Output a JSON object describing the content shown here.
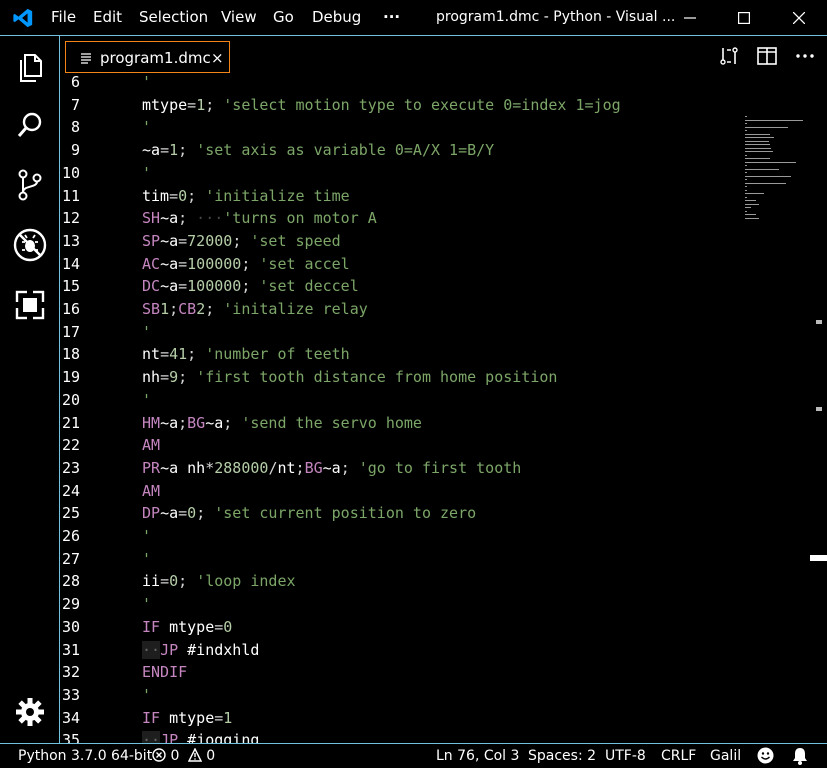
{
  "titlebar": {
    "menu": [
      "File",
      "Edit",
      "Selection",
      "View",
      "Go",
      "Debug"
    ],
    "more": "···",
    "title": "program1.dmc - Python - Visual ..."
  },
  "tab": {
    "filename": "program1.dmc",
    "close": "×"
  },
  "editor": {
    "lines": [
      {
        "n": "6",
        "t": [
          [
            "cmt",
            "'"
          ]
        ]
      },
      {
        "n": "7",
        "t": [
          [
            "var",
            "mtype"
          ],
          [
            "op",
            "="
          ],
          [
            "num",
            "1"
          ],
          [
            "op",
            ";"
          ],
          [
            "ws",
            " "
          ],
          [
            "cmt",
            "'select motion type to execute 0=index 1=jog"
          ]
        ]
      },
      {
        "n": "8",
        "t": [
          [
            "cmt",
            "'"
          ]
        ]
      },
      {
        "n": "9",
        "t": [
          [
            "var",
            "~a"
          ],
          [
            "op",
            "="
          ],
          [
            "num",
            "1"
          ],
          [
            "op",
            ";"
          ],
          [
            "ws",
            " "
          ],
          [
            "cmt",
            "'set axis as variable 0=A/X 1=B/Y"
          ]
        ]
      },
      {
        "n": "10",
        "t": [
          [
            "cmt",
            "'"
          ]
        ]
      },
      {
        "n": "11",
        "t": [
          [
            "var",
            "tim"
          ],
          [
            "op",
            "="
          ],
          [
            "num",
            "0"
          ],
          [
            "op",
            ";"
          ],
          [
            "ws",
            " "
          ],
          [
            "cmt",
            "'initialize time"
          ]
        ]
      },
      {
        "n": "12",
        "t": [
          [
            "kw",
            "SH"
          ],
          [
            "var",
            "~a"
          ],
          [
            "op",
            ";"
          ],
          [
            "ws",
            " ···"
          ],
          [
            "cmt",
            "'turns on motor A"
          ]
        ]
      },
      {
        "n": "13",
        "t": [
          [
            "kw",
            "SP"
          ],
          [
            "var",
            "~a"
          ],
          [
            "op",
            "="
          ],
          [
            "num",
            "72000"
          ],
          [
            "op",
            ";"
          ],
          [
            "ws",
            " "
          ],
          [
            "cmt",
            "'set speed"
          ]
        ]
      },
      {
        "n": "14",
        "t": [
          [
            "kw",
            "AC"
          ],
          [
            "var",
            "~a"
          ],
          [
            "op",
            "="
          ],
          [
            "num",
            "100000"
          ],
          [
            "op",
            ";"
          ],
          [
            "ws",
            " "
          ],
          [
            "cmt",
            "'set accel"
          ]
        ]
      },
      {
        "n": "15",
        "t": [
          [
            "kw",
            "DC"
          ],
          [
            "var",
            "~a"
          ],
          [
            "op",
            "="
          ],
          [
            "num",
            "100000"
          ],
          [
            "op",
            ";"
          ],
          [
            "ws",
            " "
          ],
          [
            "cmt",
            "'set deccel"
          ]
        ]
      },
      {
        "n": "16",
        "t": [
          [
            "kw",
            "SB"
          ],
          [
            "num",
            "1"
          ],
          [
            "op",
            ";"
          ],
          [
            "kw",
            "CB"
          ],
          [
            "num",
            "2"
          ],
          [
            "op",
            ";"
          ],
          [
            "ws",
            " "
          ],
          [
            "cmt",
            "'initalize relay"
          ]
        ]
      },
      {
        "n": "17",
        "t": [
          [
            "cmt",
            "'"
          ]
        ]
      },
      {
        "n": "18",
        "t": [
          [
            "var",
            "nt"
          ],
          [
            "op",
            "="
          ],
          [
            "num",
            "41"
          ],
          [
            "op",
            ";"
          ],
          [
            "ws",
            " "
          ],
          [
            "cmt",
            "'number of teeth"
          ]
        ]
      },
      {
        "n": "19",
        "t": [
          [
            "var",
            "nh"
          ],
          [
            "op",
            "="
          ],
          [
            "num",
            "9"
          ],
          [
            "op",
            ";"
          ],
          [
            "ws",
            " "
          ],
          [
            "cmt",
            "'first tooth distance from home position"
          ]
        ]
      },
      {
        "n": "20",
        "t": [
          [
            "cmt",
            "'"
          ]
        ]
      },
      {
        "n": "21",
        "t": [
          [
            "kw",
            "HM"
          ],
          [
            "var",
            "~a"
          ],
          [
            "op",
            ";"
          ],
          [
            "kw",
            "BG"
          ],
          [
            "var",
            "~a"
          ],
          [
            "op",
            ";"
          ],
          [
            "ws",
            " "
          ],
          [
            "cmt",
            "'send the servo home"
          ]
        ]
      },
      {
        "n": "22",
        "t": [
          [
            "kw",
            "AM"
          ]
        ]
      },
      {
        "n": "23",
        "t": [
          [
            "kw",
            "PR"
          ],
          [
            "var",
            "~a nh"
          ],
          [
            "op",
            "*"
          ],
          [
            "num",
            "288000"
          ],
          [
            "op",
            "/"
          ],
          [
            "var",
            "nt"
          ],
          [
            "op",
            ";"
          ],
          [
            "kw",
            "BG"
          ],
          [
            "var",
            "~a"
          ],
          [
            "op",
            ";"
          ],
          [
            "ws",
            " "
          ],
          [
            "cmt",
            "'go to first tooth"
          ]
        ]
      },
      {
        "n": "24",
        "t": [
          [
            "kw",
            "AM"
          ]
        ]
      },
      {
        "n": "25",
        "t": [
          [
            "kw",
            "DP"
          ],
          [
            "var",
            "~a"
          ],
          [
            "op",
            "="
          ],
          [
            "num",
            "0"
          ],
          [
            "op",
            ";"
          ],
          [
            "ws",
            " "
          ],
          [
            "cmt",
            "'set current position to zero"
          ]
        ]
      },
      {
        "n": "26",
        "t": [
          [
            "cmt",
            "'"
          ]
        ]
      },
      {
        "n": "27",
        "t": [
          [
            "cmt",
            "'"
          ]
        ]
      },
      {
        "n": "28",
        "t": [
          [
            "var",
            "ii"
          ],
          [
            "op",
            "="
          ],
          [
            "num",
            "0"
          ],
          [
            "op",
            ";"
          ],
          [
            "ws",
            " "
          ],
          [
            "cmt",
            "'loop index"
          ]
        ]
      },
      {
        "n": "29",
        "t": [
          [
            "cmt",
            "'"
          ]
        ]
      },
      {
        "n": "30",
        "t": [
          [
            "kw",
            "IF"
          ],
          [
            "var",
            " mtype"
          ],
          [
            "op",
            "="
          ],
          [
            "num",
            "0"
          ]
        ]
      },
      {
        "n": "31",
        "t": [
          [
            "ind",
            "··"
          ],
          [
            "kw",
            "JP"
          ],
          [
            "var",
            " #indxhld"
          ]
        ]
      },
      {
        "n": "32",
        "t": [
          [
            "kw",
            "ENDIF"
          ]
        ]
      },
      {
        "n": "33",
        "t": [
          [
            "cmt",
            "'"
          ]
        ]
      },
      {
        "n": "34",
        "t": [
          [
            "kw",
            "IF"
          ],
          [
            "var",
            " mtype"
          ],
          [
            "op",
            "="
          ],
          [
            "num",
            "1"
          ]
        ]
      },
      {
        "n": "35",
        "t": [
          [
            "ind",
            "··"
          ],
          [
            "kw",
            "JP"
          ],
          [
            "var",
            " #jogging"
          ]
        ]
      }
    ]
  },
  "status": {
    "python": "Python 3.7.0 64-bit",
    "errors": "0",
    "warnings": "0",
    "position": "Ln 76, Col 3",
    "spaces": "Spaces: 2",
    "encoding": "UTF-8",
    "eol": "CRLF",
    "language": "Galil"
  },
  "colors": {
    "accent_border": "#6fc3df",
    "active_tab_border": "#f38518",
    "logo": "#0098ff",
    "comment": "#7ca668",
    "keyword": "#c586c0",
    "number": "#b5cea8"
  },
  "icons": [
    "vscode-logo-icon",
    "minimize-icon",
    "maximize-icon",
    "close-icon",
    "files-icon",
    "search-icon",
    "source-control-icon",
    "debug-icon",
    "extensions-icon",
    "settings-gear-icon",
    "file-icon",
    "open-changes-icon",
    "split-editor-icon",
    "more-actions-icon",
    "error-icon",
    "warning-icon",
    "feedback-smiley-icon",
    "bell-icon"
  ]
}
